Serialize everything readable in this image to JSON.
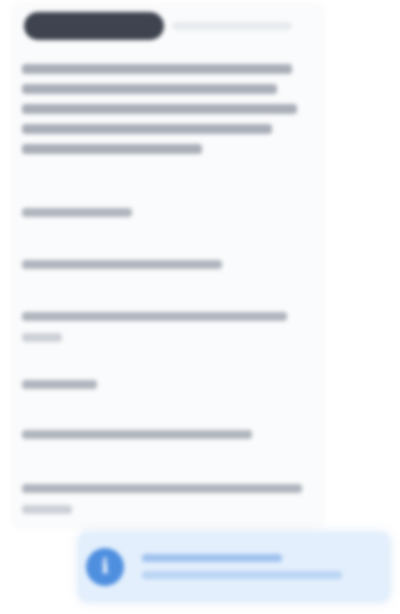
{
  "panel": {
    "title": ""
  },
  "toast": {
    "icon": "info-icon",
    "accent_color": "#4f8fe0"
  }
}
